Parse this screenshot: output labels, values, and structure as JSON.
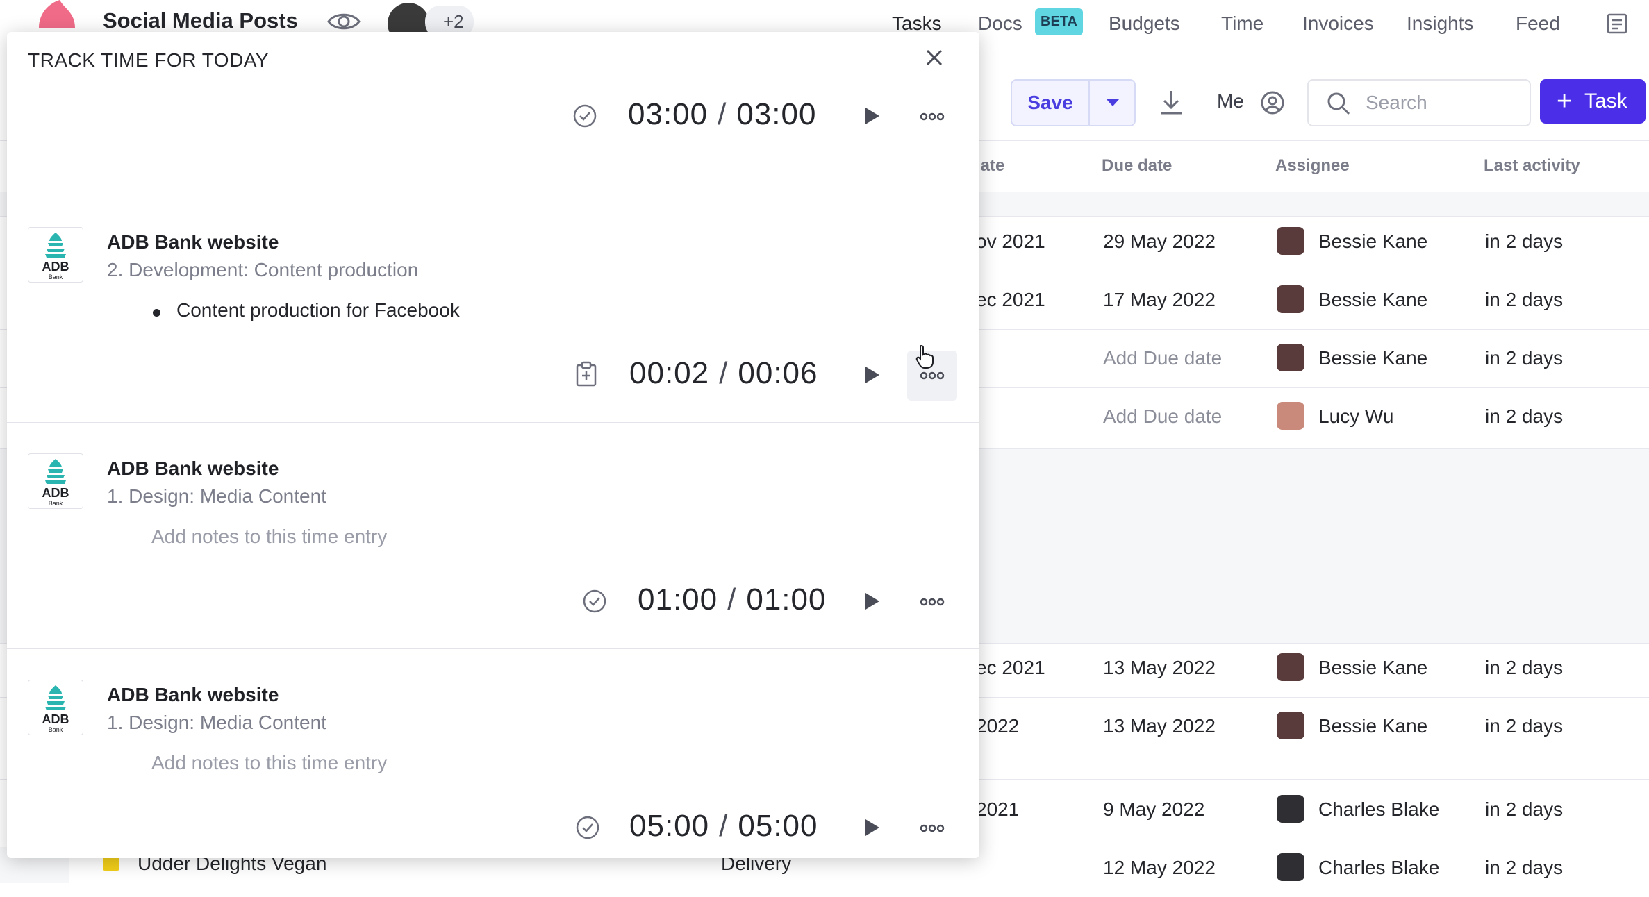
{
  "header": {
    "project_title": "Social Media Posts",
    "collaborators_more": "+2",
    "nav": [
      "Tasks",
      "Docs",
      "Budgets",
      "Time",
      "Invoices",
      "Insights",
      "Feed"
    ],
    "docs_badge": "BETA"
  },
  "toolbar": {
    "save_label": "Save",
    "me_label": "Me",
    "search_placeholder": "Search",
    "task_button": "Task"
  },
  "table": {
    "columns": [
      "late",
      "Due date",
      "Assignee",
      "Last activity"
    ],
    "rows": [
      {
        "start": "ov 2021",
        "due": "29 May 2022",
        "assignee": "Bessie Kane",
        "activity": "in 2 days"
      },
      {
        "start": "ec 2021",
        "due": "17 May 2022",
        "assignee": "Bessie Kane",
        "activity": "in 2 days"
      },
      {
        "start": "",
        "due": "Add Due date",
        "assignee": "Bessie Kane",
        "activity": "in 2 days"
      },
      {
        "start": "",
        "due": "Add Due date",
        "assignee": "Lucy Wu",
        "activity": "in 2 days"
      },
      {
        "start": "ec 2021",
        "due": "13 May 2022",
        "assignee": "Bessie Kane",
        "activity": "in 2 days"
      },
      {
        "start": "2022",
        "due": "13 May 2022",
        "assignee": "Bessie Kane",
        "activity": "in 2 days"
      },
      {
        "start": "2021",
        "due": "9 May 2022",
        "assignee": "Charles Blake",
        "activity": "in 2 days"
      },
      {
        "start": "",
        "due": "12 May 2022",
        "assignee": "Charles Blake",
        "activity": "in 2 days"
      }
    ],
    "partial_row": {
      "name": "Udder Delights Vegan",
      "stage": "Delivery"
    }
  },
  "modal": {
    "title": "TRACK TIME FOR TODAY",
    "entries": [
      {
        "tracked": "03:00",
        "estimate": "03:00",
        "status": "done"
      },
      {
        "client_logo_text": "ADB",
        "client_logo_sub": "Bank",
        "project": "ADB Bank website",
        "task": "2. Development: Content production",
        "note": "Content production for Facebook",
        "tracked": "00:02",
        "estimate": "00:06",
        "status": "running"
      },
      {
        "client_logo_text": "ADB",
        "client_logo_sub": "Bank",
        "project": "ADB Bank website",
        "task": "1. Design: Media Content",
        "note_placeholder": "Add notes to this time entry",
        "tracked": "01:00",
        "estimate": "01:00",
        "status": "done"
      },
      {
        "client_logo_text": "ADB",
        "client_logo_sub": "Bank",
        "project": "ADB Bank website",
        "task": "1. Design: Media Content",
        "note_placeholder": "Add notes to this time entry",
        "tracked": "05:00",
        "estimate": "05:00",
        "status": "done"
      }
    ]
  },
  "icons": {
    "close": "close-icon",
    "play": "play-icon",
    "more": "more-icon",
    "check": "check-circle-icon",
    "clipboard": "clipboard-icon",
    "search": "search-icon",
    "download": "download-icon",
    "user": "user-circle-icon"
  },
  "colors": {
    "accent": "#4b2fe8",
    "beta_badge": "#5fd6e2",
    "brand_teal": "#2bb5b0"
  }
}
